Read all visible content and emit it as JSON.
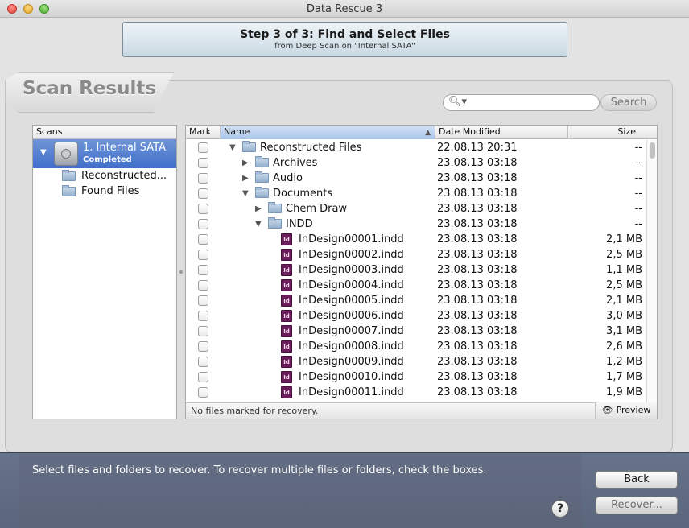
{
  "window": {
    "title": "Data Rescue 3"
  },
  "step": {
    "title": "Step 3 of 3: Find and Select Files",
    "subtitle": "from Deep Scan on \"Internal SATA\""
  },
  "results": {
    "title": "Scan Results"
  },
  "search": {
    "placeholder": "",
    "button_label": "Search"
  },
  "scans": {
    "header": "Scans",
    "selected": {
      "name": "1. Internal SATA",
      "status": "Completed"
    },
    "items": [
      {
        "label": "Reconstructed..."
      },
      {
        "label": "Found Files"
      }
    ]
  },
  "file_table": {
    "columns": {
      "mark": "Mark",
      "name": "Name",
      "date": "Date Modified",
      "size": "Size"
    },
    "rows": [
      {
        "name": "Reconstructed Files",
        "date": "22.08.13 20:31",
        "size": "--",
        "icon": "folder-icon",
        "indent": 0,
        "disclosure": "open"
      },
      {
        "name": "Archives",
        "date": "23.08.13 03:18",
        "size": "--",
        "icon": "folder-icon",
        "indent": 1,
        "disclosure": "closed"
      },
      {
        "name": "Audio",
        "date": "23.08.13 03:18",
        "size": "--",
        "icon": "folder-icon",
        "indent": 1,
        "disclosure": "closed"
      },
      {
        "name": "Documents",
        "date": "23.08.13 03:18",
        "size": "--",
        "icon": "folder-icon",
        "indent": 1,
        "disclosure": "open"
      },
      {
        "name": "Chem Draw",
        "date": "23.08.13 03:18",
        "size": "--",
        "icon": "folder-icon",
        "indent": 2,
        "disclosure": "closed"
      },
      {
        "name": "INDD",
        "date": "23.08.13 03:18",
        "size": "--",
        "icon": "folder-icon",
        "indent": 2,
        "disclosure": "open"
      },
      {
        "name": "InDesign00001.indd",
        "date": "23.08.13 03:18",
        "size": "2,1 MB",
        "icon": "indd-file-icon",
        "indent": 3,
        "disclosure": "none"
      },
      {
        "name": "InDesign00002.indd",
        "date": "23.08.13 03:18",
        "size": "2,5 MB",
        "icon": "indd-file-icon",
        "indent": 3,
        "disclosure": "none"
      },
      {
        "name": "InDesign00003.indd",
        "date": "23.08.13 03:18",
        "size": "1,1 MB",
        "icon": "indd-file-icon",
        "indent": 3,
        "disclosure": "none"
      },
      {
        "name": "InDesign00004.indd",
        "date": "23.08.13 03:18",
        "size": "2,5 MB",
        "icon": "indd-file-icon",
        "indent": 3,
        "disclosure": "none"
      },
      {
        "name": "InDesign00005.indd",
        "date": "23.08.13 03:18",
        "size": "2,1 MB",
        "icon": "indd-file-icon",
        "indent": 3,
        "disclosure": "none"
      },
      {
        "name": "InDesign00006.indd",
        "date": "23.08.13 03:18",
        "size": "3,0 MB",
        "icon": "indd-file-icon",
        "indent": 3,
        "disclosure": "none"
      },
      {
        "name": "InDesign00007.indd",
        "date": "23.08.13 03:18",
        "size": "3,1 MB",
        "icon": "indd-file-icon",
        "indent": 3,
        "disclosure": "none"
      },
      {
        "name": "InDesign00008.indd",
        "date": "23.08.13 03:18",
        "size": "2,6 MB",
        "icon": "indd-file-icon",
        "indent": 3,
        "disclosure": "none"
      },
      {
        "name": "InDesign00009.indd",
        "date": "23.08.13 03:18",
        "size": "1,2 MB",
        "icon": "indd-file-icon",
        "indent": 3,
        "disclosure": "none"
      },
      {
        "name": "InDesign00010.indd",
        "date": "23.08.13 03:18",
        "size": "1,7 MB",
        "icon": "indd-file-icon",
        "indent": 3,
        "disclosure": "none"
      },
      {
        "name": "InDesign00011.indd",
        "date": "23.08.13 03:18",
        "size": "1,9 MB",
        "icon": "indd-file-icon",
        "indent": 3,
        "disclosure": "none"
      }
    ],
    "status": "No files marked for recovery.",
    "preview_label": "Preview"
  },
  "footer": {
    "instructions": "Select files and folders to recover. To recover multiple files or folders, check the boxes.",
    "help_label": "?",
    "back_label": "Back",
    "recover_label": "Recover..."
  },
  "colors": {
    "selection": "#3f6fcb",
    "bottom_bar": "#5f6a80",
    "indd_icon": "#6b1d5b"
  }
}
